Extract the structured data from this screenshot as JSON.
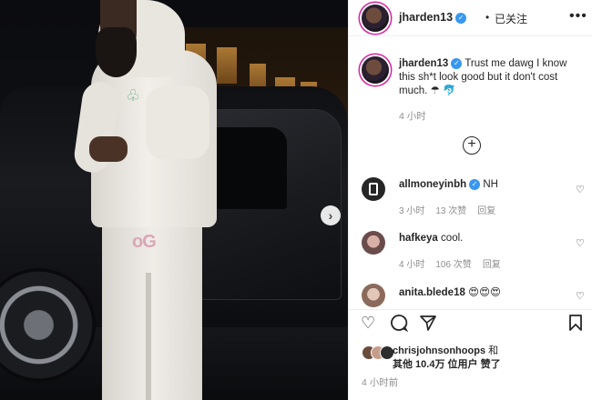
{
  "post": {
    "username": "jharden13",
    "follow_status": "已关注",
    "separator": "•"
  },
  "caption": {
    "username": "jharden13",
    "text": "Trust me dawg I know this sh*t look good but it don't cost much. ☂ 🐬",
    "time": "4 小时"
  },
  "comments": [
    {
      "username": "allmoneyinbh",
      "verified": true,
      "text": "NH",
      "time": "3 小时",
      "likes": "13 次赞",
      "reply": "回复",
      "avatar_color": "#2a2a2a"
    },
    {
      "username": "hafkeya",
      "verified": false,
      "text": "cool.",
      "time": "4 小时",
      "likes": "106 次赞",
      "reply": "回复",
      "avatar_color": "#b98a86"
    },
    {
      "username": "anita.blede18",
      "verified": false,
      "text": "😍😍😍",
      "time": "",
      "likes": "",
      "reply": "",
      "avatar_color": "#c7a89a"
    }
  ],
  "footer": {
    "liked_by_user": "chrisjohnsonhoops",
    "liked_connector": "和",
    "liked_others": "其他 10.4万 位用户 赞了",
    "time": "4 小时前"
  },
  "icons": {
    "verified": "verified-badge-icon",
    "more": "more-options-icon",
    "add_comment": "plus-circle-icon",
    "like": "heart-icon",
    "comment": "speech-bubble-icon",
    "share": "paper-plane-icon",
    "save": "bookmark-icon",
    "next": "chevron-right-icon"
  },
  "colors": {
    "verified": "#3897f0",
    "muted_text": "#8e8e8e",
    "story_ring": "#d6249f"
  }
}
